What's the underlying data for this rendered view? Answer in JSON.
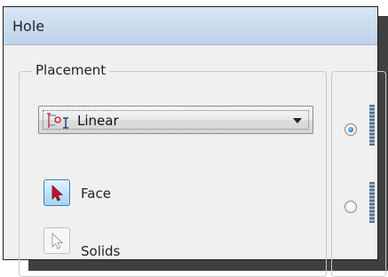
{
  "window": {
    "title": "Hole"
  },
  "placement": {
    "group_label": "Placement",
    "type_select": {
      "value": "Linear",
      "icon": "linear-placement-icon"
    },
    "selectors": [
      {
        "label": "Face",
        "icon": "arrow-select-icon",
        "active": true
      },
      {
        "label": "Solids",
        "icon": "arrow-select-icon",
        "active": false
      }
    ]
  },
  "options": {
    "radios": [
      {
        "selected": true
      },
      {
        "selected": false
      }
    ]
  },
  "colors": {
    "accent": "#3c7fb1",
    "arrow_red": "#c8102e",
    "titlebar": "#c9dbee"
  }
}
